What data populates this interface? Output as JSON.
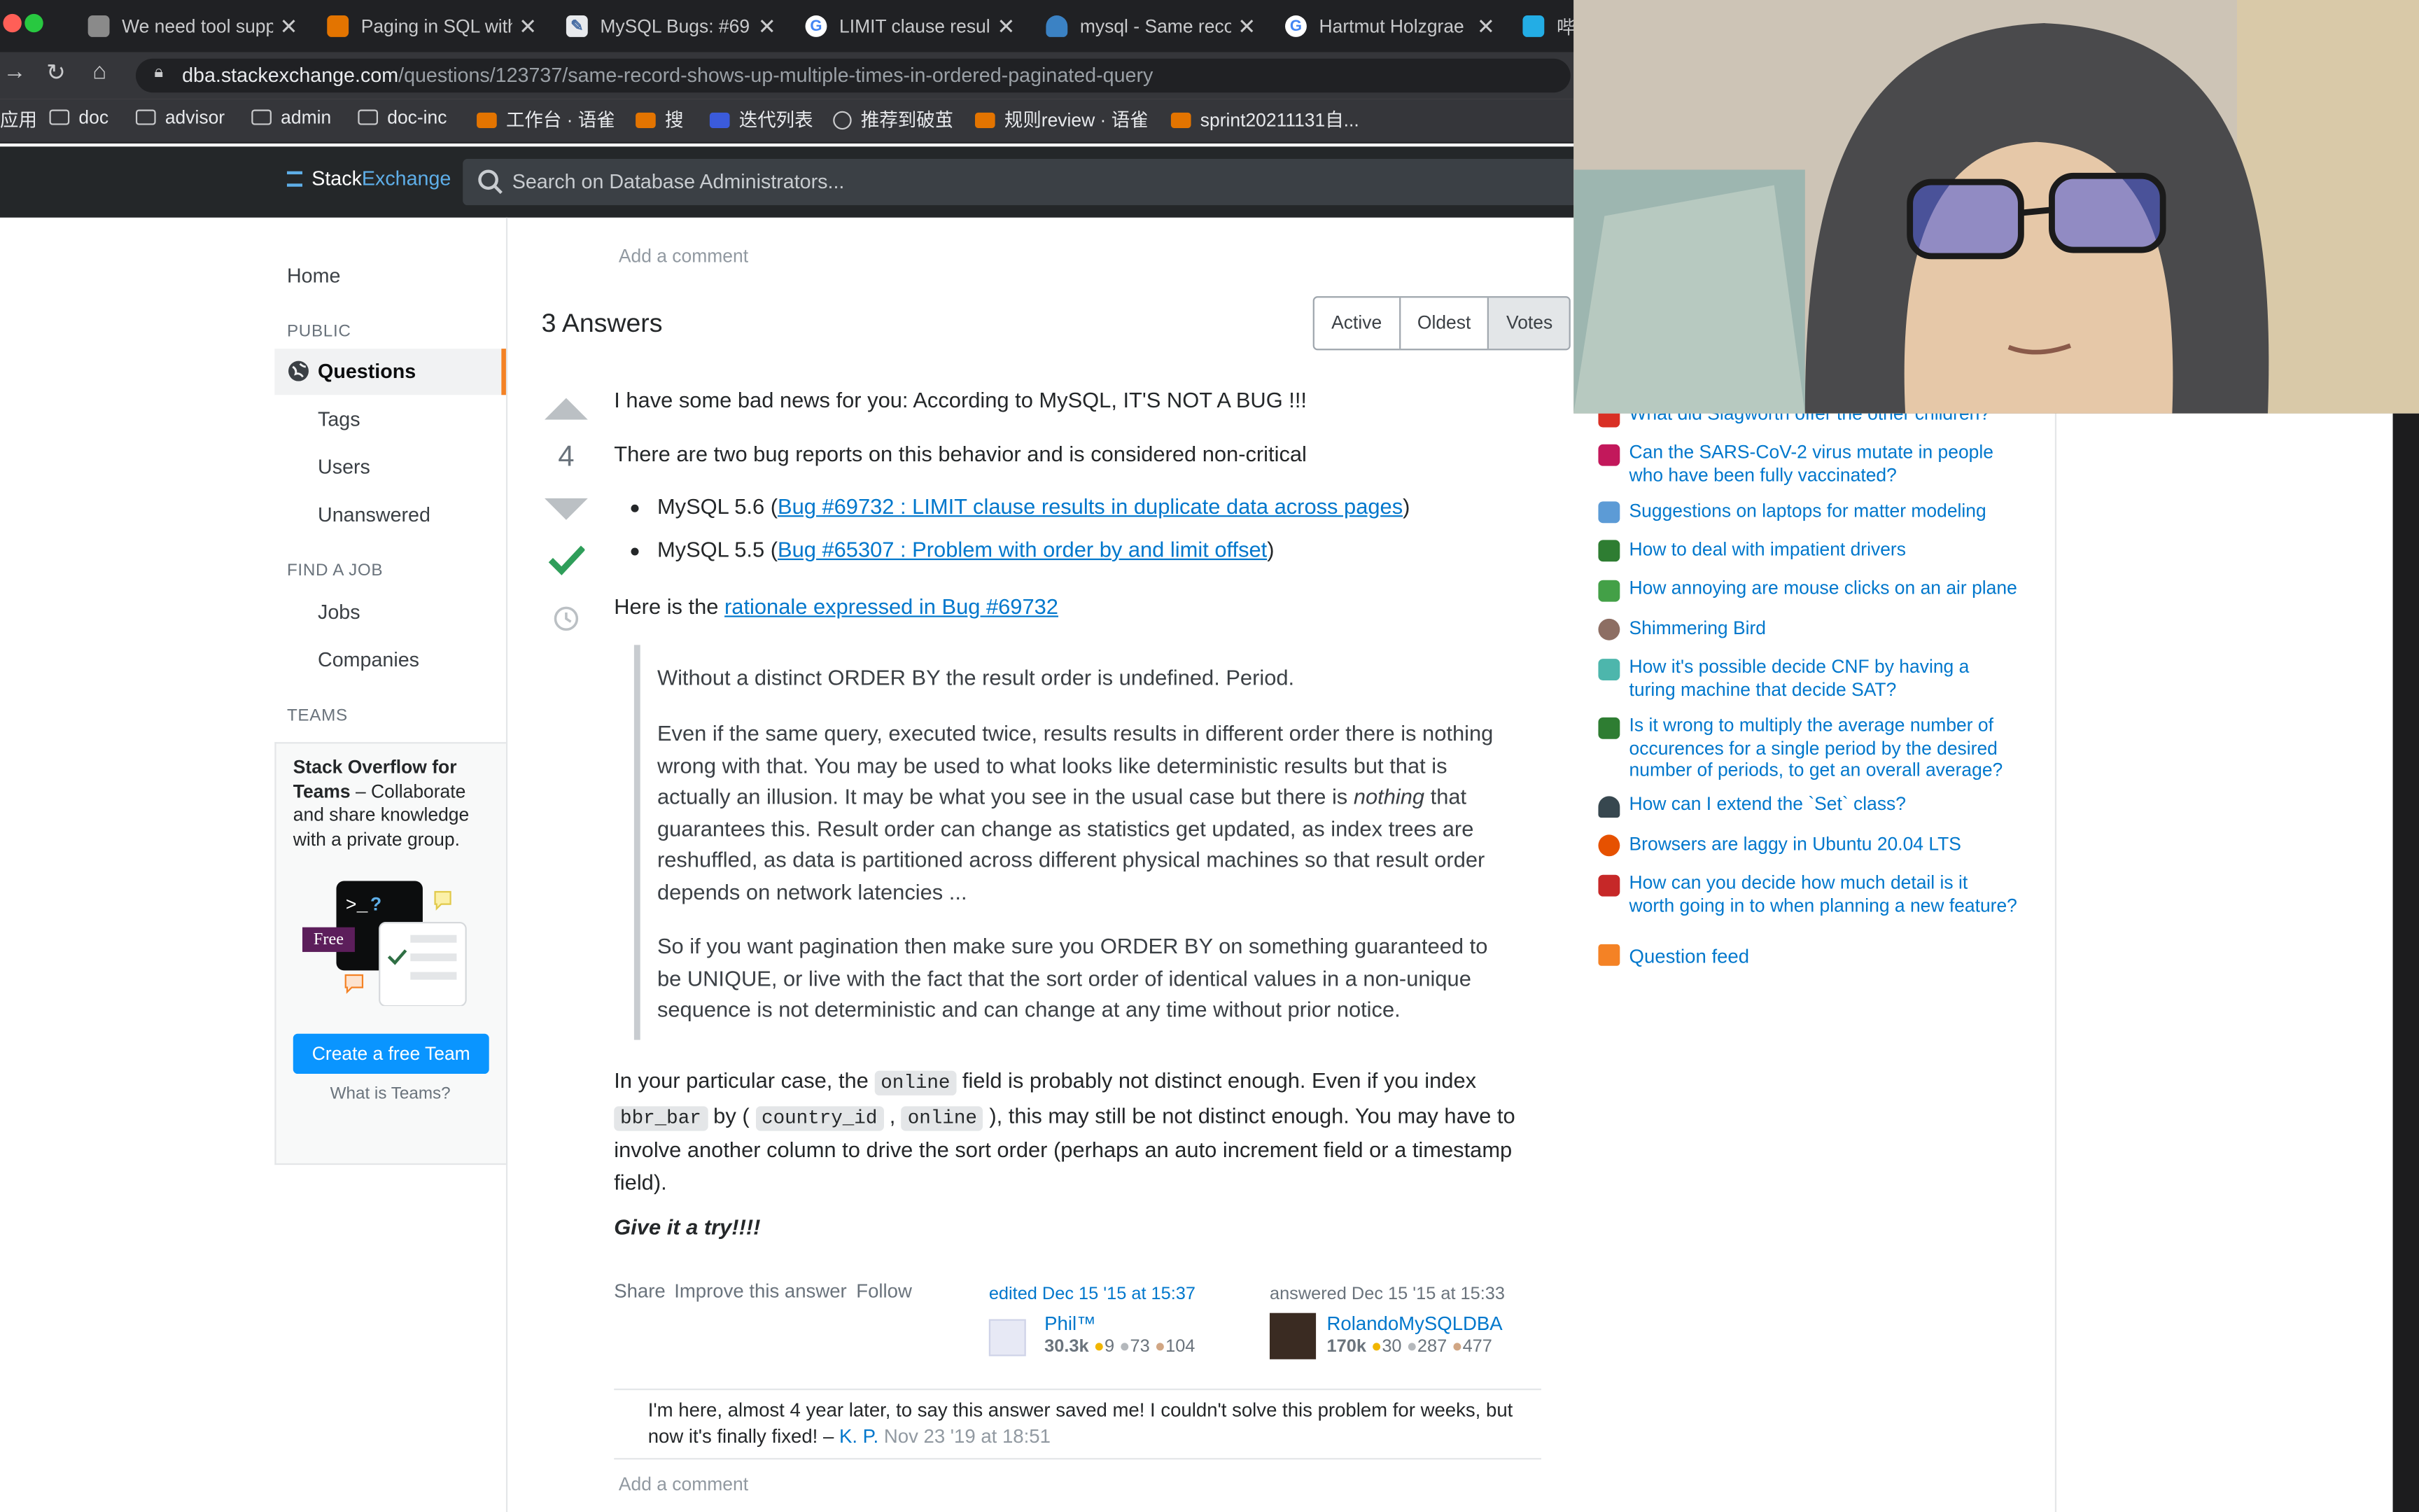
{
  "browser": {
    "tabs": [
      {
        "title": "We need tool supp",
        "icon": "user-avatar-favicon",
        "color": "#8a8a8a"
      },
      {
        "title": "Paging in SQL with",
        "icon": "feather-favicon",
        "color": "#e37400"
      },
      {
        "title": "MySQL Bugs: #69",
        "icon": "document-favicon",
        "color": "#4a6fa5"
      },
      {
        "title": "LIMIT clause resul",
        "icon": "google-favicon",
        "color": "#ffffff"
      },
      {
        "title": "mysql - Same reco",
        "icon": "database-favicon",
        "color": "#3b82c4"
      },
      {
        "title": "Hartmut Holzgrae",
        "icon": "google-favicon",
        "color": "#ffffff"
      },
      {
        "title": "哔",
        "icon": "tv-favicon",
        "color": "#23ade5"
      }
    ],
    "url_host": "dba.stackexchange.com",
    "url_path": "/questions/123737/same-record-shows-up-multiple-times-in-ordered-paginated-query",
    "bookmarks": [
      "应用",
      "doc",
      "advisor",
      "admin",
      "doc-inc",
      "工作台 · 语雀",
      "搜",
      "迭代列表",
      "推荐到破茧",
      "规则review · 语雀",
      "sprint20211131自..."
    ]
  },
  "header": {
    "logo_stack": "Stack",
    "logo_exchange": "Exchange",
    "search_placeholder": "Search on Database Administrators..."
  },
  "leftnav": {
    "home": "Home",
    "public_label": "PUBLIC",
    "questions": "Questions",
    "tags": "Tags",
    "users": "Users",
    "unanswered": "Unanswered",
    "find_job_label": "FIND A JOB",
    "jobs": "Jobs",
    "companies": "Companies",
    "teams_label": "TEAMS",
    "teams_title": "Stack Overflow for Teams",
    "teams_desc": " – Collaborate and share knowledge with a private group.",
    "teams_free": "Free",
    "create_team": "Create a free Team",
    "what_teams": "What is Teams?"
  },
  "main": {
    "add_comment_top": "Add a comment",
    "answers_title": "3 Answers",
    "sort_tabs": [
      "Active",
      "Oldest",
      "Votes"
    ],
    "answer": {
      "votes": "4",
      "p1": "I have some bad news for you: According to MySQL, IT'S NOT A BUG !!!",
      "p2": "There are two bug reports on this behavior and is considered non-critical",
      "li1_prefix": "MySQL 5.6 (",
      "li1_link": "Bug #69732 : LIMIT clause results in duplicate data across pages",
      "li1_suffix": ")",
      "li2_prefix": "MySQL 5.5 (",
      "li2_link": "Bug #65307 : Problem with order by and limit offset",
      "li2_suffix": ")",
      "p3_prefix": "Here is the ",
      "p3_link": "rationale expressed in Bug #69732",
      "q1": "Without a distinct ORDER BY the result order is undefined. Period.",
      "q2_a": "Even if the same query, executed twice, results results in different order there is nothing wrong with that. You may be used to what looks like deterministic results but that is actually an illusion. It may be what you see in the usual case but there is ",
      "q2_em": "nothing",
      "q2_b": " that guarantees this. Result order can change as statistics get updated, as index trees are reshuffled, as data is partitioned across different physical machines so that result order depends on network latencies ...",
      "q3": "So if you want pagination then make sure you ORDER BY on something guaranteed to be UNIQUE, or live with the fact that the sort order of identical values in a non-unique sequence is not deterministic and can change at any time without prior notice.",
      "p4_a": "In your particular case, the ",
      "p4_code1": "online",
      "p4_b": " field is probably not distinct enough. Even if you index ",
      "p4_code2": "bbr_bar",
      "p4_c": " by ( ",
      "p4_code3": "country_id",
      "p4_d": " , ",
      "p4_code4": "online",
      "p4_e": " ), this may still be not distinct enough. You may have to involve another column to drive the sort order (perhaps an auto increment field or a timestamp field).",
      "p5": "Give it a try!!!!",
      "actions": [
        "Share",
        "Improve this answer",
        "Follow"
      ],
      "edited": "edited Dec 15 '15 at 15:37",
      "editor_name": "Phil™",
      "editor_rep": "30.3k",
      "editor_badges": [
        "9",
        "73",
        "104"
      ],
      "answered": "answered Dec 15 '15 at 15:33",
      "author_name": "RolandoMySQLDBA",
      "author_rep": "170k",
      "author_badges": [
        "30",
        "287",
        "477"
      ],
      "comment_text": "I'm here, almost 4 year later, to say this answer saved me! I couldn't solve this problem for weeks, but now it's finally fixed! –",
      "comment_user": "K. P.",
      "comment_date": "Nov 23 '19 at 18:51",
      "add_comment": "Add a comment"
    }
  },
  "hot_questions": [
    {
      "title": "What did Slagworth offer the other children?",
      "icon_color": "#d93025"
    },
    {
      "title": "Can the SARS-CoV-2 virus mutate in people who have been fully vaccinated?",
      "icon_color": "#c2185b"
    },
    {
      "title": "Suggestions on laptops for matter modeling",
      "icon_color": "#5c9bd6"
    },
    {
      "title": "How to deal with impatient drivers",
      "icon_color": "#2e7d32"
    },
    {
      "title": "How annoying are mouse clicks on an air plane",
      "icon_color": "#43a047"
    },
    {
      "title": "Shimmering Bird",
      "icon_color": "#8d6e63"
    },
    {
      "title": "How it's possible decide CNF by having a turing machine that decide SAT?",
      "icon_color": "#4db6ac"
    },
    {
      "title": "Is it wrong to multiply the average number of occurences for a single period by the desired number of periods, to get an overall average?",
      "icon_color": "#2e7d32"
    },
    {
      "title": "How can I extend the `Set` class?",
      "icon_color": "#37474f"
    },
    {
      "title": "Browsers are laggy in Ubuntu 20.04 LTS",
      "icon_color": "#e65100"
    },
    {
      "title": "How can you decide how much detail is it worth going in to when planning a new feature?",
      "icon_color": "#c62828"
    }
  ],
  "question_feed": "Question feed"
}
